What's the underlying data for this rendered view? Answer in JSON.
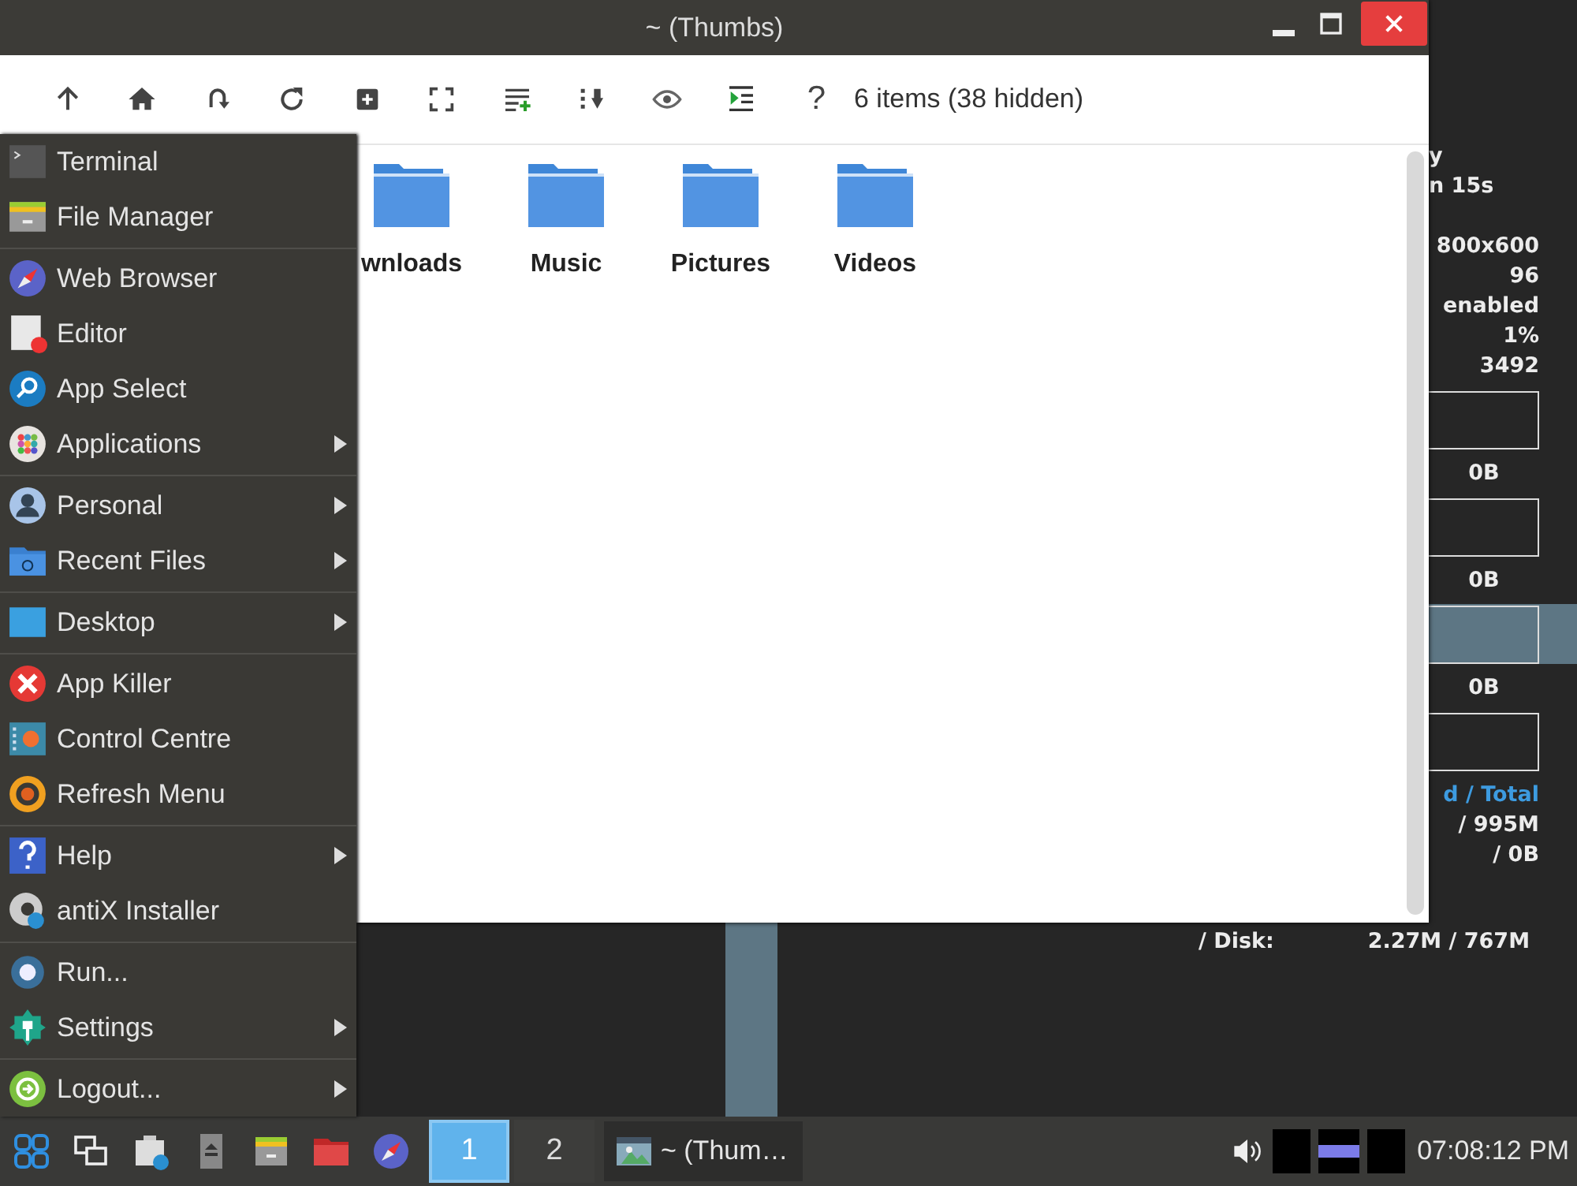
{
  "window": {
    "title": "~ (Thumbs)",
    "toolbar": {
      "help": "?",
      "status": "6 items (38 hidden)"
    },
    "folders": [
      {
        "name": "wnloads"
      },
      {
        "name": "Music"
      },
      {
        "name": "Pictures"
      },
      {
        "name": "Videos"
      }
    ]
  },
  "menu": {
    "groups": [
      [
        {
          "label": "Terminal",
          "submenu": false
        },
        {
          "label": "File Manager",
          "submenu": false
        }
      ],
      [
        {
          "label": "Web Browser",
          "submenu": false
        },
        {
          "label": "Editor",
          "submenu": false
        },
        {
          "label": "App Select",
          "submenu": false
        },
        {
          "label": "Applications",
          "submenu": true
        }
      ],
      [
        {
          "label": "Personal",
          "submenu": true
        },
        {
          "label": "Recent Files",
          "submenu": true
        }
      ],
      [
        {
          "label": "Desktop",
          "submenu": true
        }
      ],
      [
        {
          "label": "App Killer",
          "submenu": false
        },
        {
          "label": "Control Centre",
          "submenu": false
        },
        {
          "label": "Refresh Menu",
          "submenu": false
        }
      ],
      [
        {
          "label": "Help",
          "submenu": true
        },
        {
          "label": "antiX Installer",
          "submenu": false
        }
      ],
      [
        {
          "label": "Run...",
          "submenu": false
        },
        {
          "label": "Settings",
          "submenu": true
        }
      ],
      [
        {
          "label": "Logout...",
          "submenu": true
        }
      ]
    ]
  },
  "conky": {
    "rows": [
      {
        "kind": "left",
        "text": "y"
      },
      {
        "kind": "left",
        "text": "n 15s"
      },
      {
        "kind": "gap"
      },
      {
        "kind": "right",
        "text": "800x600"
      },
      {
        "kind": "right",
        "text": "96"
      },
      {
        "kind": "right",
        "text": "enabled"
      },
      {
        "kind": "right",
        "text": "1%"
      },
      {
        "kind": "right",
        "text": "3492"
      },
      {
        "kind": "graph"
      },
      {
        "kind": "center",
        "text": "0B"
      },
      {
        "kind": "graph"
      },
      {
        "kind": "center",
        "text": "0B"
      },
      {
        "kind": "graph"
      },
      {
        "kind": "center",
        "text": "0B"
      },
      {
        "kind": "graph"
      },
      {
        "kind": "accent",
        "text": "d / Total"
      },
      {
        "kind": "right",
        "text": "/ 995M"
      },
      {
        "kind": "right",
        "text": "/ 0B"
      }
    ],
    "disk": {
      "label": "/ Disk:",
      "value": "2.27M / 767M"
    }
  },
  "taskbar": {
    "desktops": [
      {
        "label": "1",
        "selected": true
      },
      {
        "label": "2",
        "selected": false
      }
    ],
    "task": {
      "title": "~ (Thum…"
    },
    "clock": "07:08:12 PM"
  }
}
